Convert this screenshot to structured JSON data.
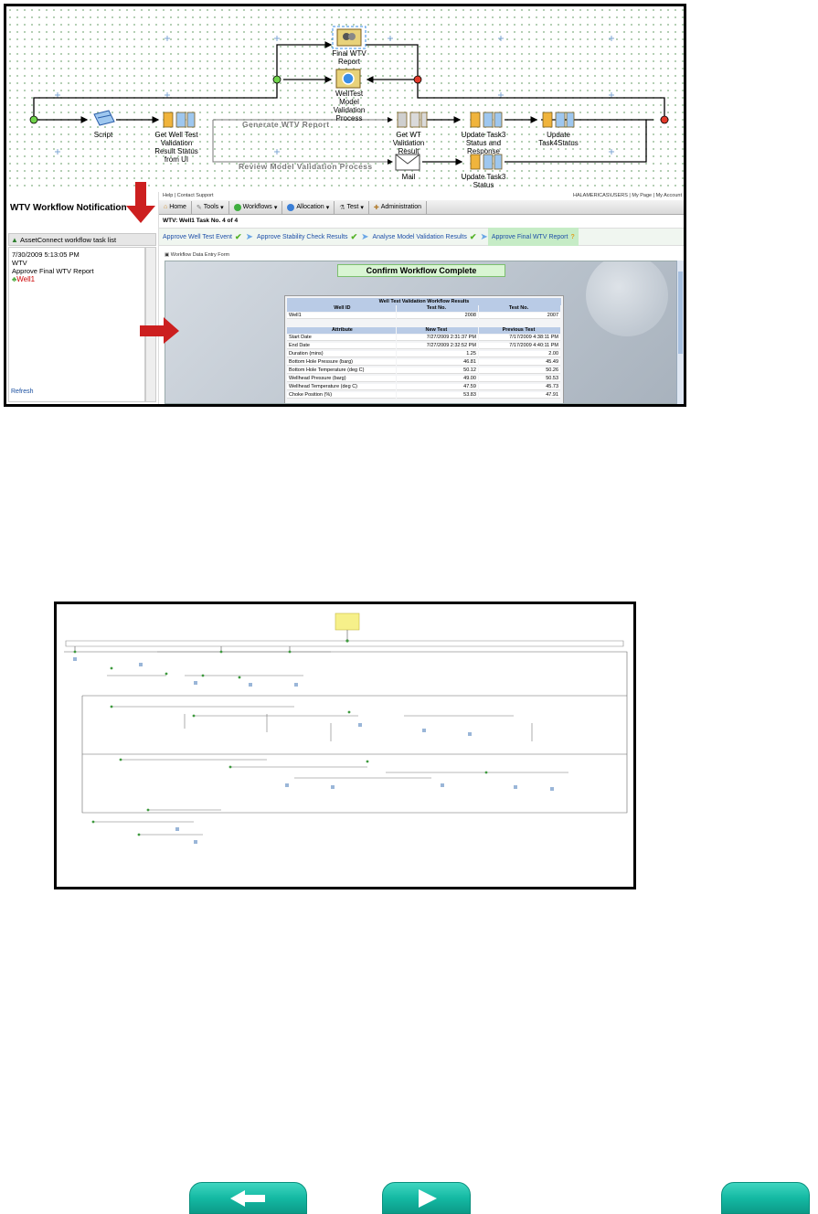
{
  "workflow": {
    "nodes": {
      "final_report": "Final WTV\nReport",
      "model_validation": "WellTest\nModel\nValidation\nProcess",
      "script": "Script",
      "get_status": "Get Well Test\nValidation\nResult Status\nfrom UI",
      "get_wt_result": "Get WT\nValidation\nResult",
      "update_task3_response": "Update Task3\nStatus and\nResponse",
      "update_task4": "Update\nTask4Status",
      "mail": "Mail",
      "update_task3": "Update Task3\nStatus"
    },
    "paths": {
      "generate": "Generate WTV Report",
      "review": "Review Model Validation Process"
    }
  },
  "notification": {
    "title": "WTV Workflow Notification",
    "list_header": "AssetConnect workflow task list",
    "task_date": "7/30/2009 5:13:05 PM",
    "task_type": "WTV",
    "task_name": "Approve Final WTV Report",
    "task_well": "Well1",
    "refresh": "Refresh"
  },
  "app": {
    "topline": "Help | Contact Support",
    "topright": "HALAMERICAS\\USERS | My Page | My Account",
    "nav": [
      "Home",
      "Tools",
      "Workflows",
      "Allocation",
      "Test",
      "Administration"
    ],
    "task_title": "WTV: Well1 Task No. 4 of 4",
    "steps": [
      {
        "label": "Approve Well Test Event",
        "done": true
      },
      {
        "label": "Approve Stability Check Results",
        "done": true
      },
      {
        "label": "Analyse Model Validation Results",
        "done": true
      },
      {
        "label": "Approve Final WTV Report",
        "done": false
      }
    ],
    "form_tab": "Workflow Data Entry Form",
    "confirm_button": "Confirm Workflow Complete",
    "results": {
      "caption": "Well Test Validation Workflow Results",
      "well_headers": [
        "Well ID",
        "Test No.",
        "Test No."
      ],
      "well_row": [
        "Well1",
        "2008",
        "2007"
      ],
      "attr_headers": [
        "Attribute",
        "New Test",
        "Previous Test"
      ],
      "rows": [
        [
          "Start Date",
          "7/27/2009 2:31:37 PM",
          "7/17/2009 4:38:11 PM"
        ],
        [
          "End Date",
          "7/27/2009 2:32:52 PM",
          "7/17/2009 4:40:11 PM"
        ],
        [
          "Duration (mins)",
          "1.25",
          "2.00"
        ],
        [
          "Bottom Hole Pressure (barg)",
          "46.81",
          "45.49"
        ],
        [
          "Bottom Hole Temperature (deg C)",
          "50.12",
          "50.26"
        ],
        [
          "Wellhead Pressure (barg)",
          "49.00",
          "50.53"
        ],
        [
          "Wellhead Temperature (deg C)",
          "47.59",
          "45.73"
        ],
        [
          "Choke Position (%)",
          "53.83",
          "47.91"
        ]
      ]
    }
  },
  "colors": {
    "accent_red": "#cc1f1f",
    "nav_teal": "#14b9a3",
    "step_active": "#c6ecc6"
  },
  "buttons": {
    "prev_icon": "left-arrow-icon",
    "next_icon": "right-arrow-icon",
    "home_icon": "home-icon"
  }
}
